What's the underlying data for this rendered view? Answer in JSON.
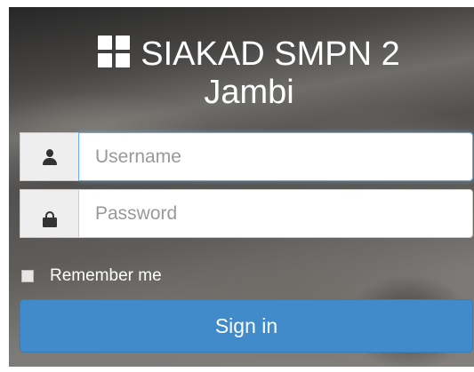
{
  "header": {
    "icon": "grid-icon",
    "title_line1": "SIAKAD SMPN 2",
    "title_line2": "Jambi"
  },
  "form": {
    "username": {
      "icon": "user-icon",
      "placeholder": "Username",
      "value": ""
    },
    "password": {
      "icon": "lock-icon",
      "placeholder": "Password",
      "value": ""
    },
    "remember_label": "Remember me",
    "remember_checked": false,
    "submit_label": "Sign in"
  },
  "colors": {
    "primary": "#428bca",
    "focus": "#66afe9"
  }
}
